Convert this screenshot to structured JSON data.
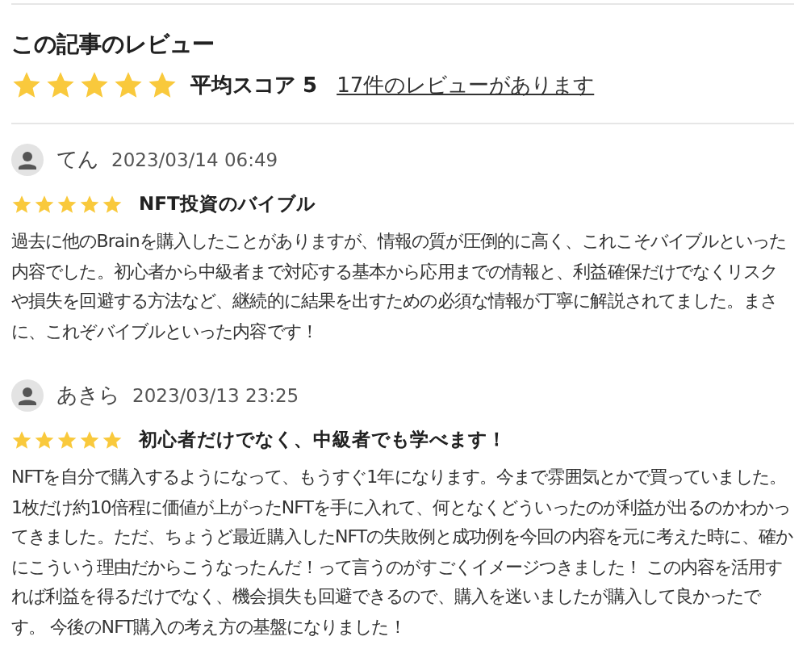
{
  "summary": {
    "title": "この記事のレビュー",
    "stars": 5,
    "score_label": "平均スコア 5",
    "reviews_link": "17件のレビューがあります"
  },
  "reviews": [
    {
      "author": "てん",
      "date": "2023/03/14 06:49",
      "stars": 5,
      "headline": "NFT投資のバイブル",
      "body": "過去に他のBrainを購入したことがありますが、情報の質が圧倒的に高く、これこそバイブルといった内容でした。初心者から中級者まで対応する基本から応用までの情報と、利益確保だけでなくリスクや損失を回避する方法など、継続的に結果を出すための必須な情報が丁寧に解説されてました。まさに、これぞバイブルといった内容です！"
    },
    {
      "author": "あきら",
      "date": "2023/03/13 23:25",
      "stars": 5,
      "headline": "初心者だけでなく、中級者でも学べます！",
      "body": "NFTを自分で購入するようになって、もうすぐ1年になります。今まで雰囲気とかで買っていました。1枚だけ約10倍程に価値が上がったNFTを手に入れて、何となくどういったのが利益が出るのかわかってきました。ただ、ちょうど最近購入したNFTの失敗例と成功例を今回の内容を元に考えた時に、確かにこういう理由だからこうなったんだ！って言うのがすごくイメージつきました！ この内容を活用すれば利益を得るだけでなく、機会損失も回避できるので、購入を迷いましたが購入して良かったです。 今後のNFT購入の考え方の基盤になりました！"
    }
  ]
}
